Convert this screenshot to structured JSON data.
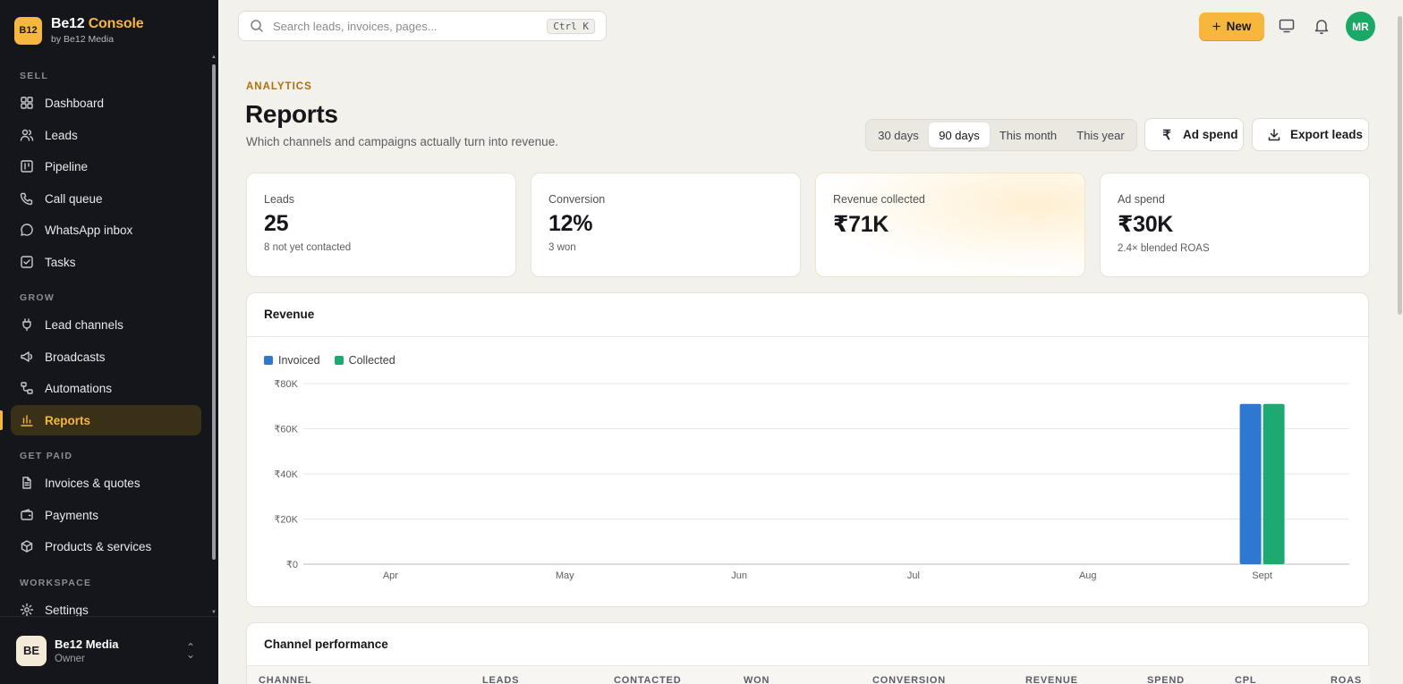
{
  "brand": {
    "logo_text": "B12",
    "name_first": "Be12",
    "name_second": "Console",
    "sub": "by Be12 Media"
  },
  "sidebar": {
    "sections": [
      {
        "label": "SELL",
        "items": [
          {
            "label": "Dashboard",
            "icon": "grid-icon"
          },
          {
            "label": "Leads",
            "icon": "users-icon"
          },
          {
            "label": "Pipeline",
            "icon": "kanban-icon"
          },
          {
            "label": "Call queue",
            "icon": "phone-icon"
          },
          {
            "label": "WhatsApp inbox",
            "icon": "chat-icon"
          },
          {
            "label": "Tasks",
            "icon": "checkbox-icon"
          }
        ]
      },
      {
        "label": "GROW",
        "items": [
          {
            "label": "Lead channels",
            "icon": "plug-icon"
          },
          {
            "label": "Broadcasts",
            "icon": "megaphone-icon"
          },
          {
            "label": "Automations",
            "icon": "workflow-icon"
          },
          {
            "label": "Reports",
            "icon": "bar-chart-icon",
            "active": true
          }
        ]
      },
      {
        "label": "GET PAID",
        "items": [
          {
            "label": "Invoices & quotes",
            "icon": "document-icon"
          },
          {
            "label": "Payments",
            "icon": "wallet-icon"
          },
          {
            "label": "Products & services",
            "icon": "box-icon"
          }
        ]
      },
      {
        "label": "WORKSPACE",
        "items": [
          {
            "label": "Settings",
            "icon": "gear-icon"
          }
        ]
      }
    ],
    "account": {
      "initials": "BE",
      "name": "Be12 Media",
      "role": "Owner"
    }
  },
  "topbar": {
    "search_placeholder": "Search leads, invoices, pages...",
    "shortcut": "Ctrl K",
    "new_label": "New",
    "user_initials": "MR"
  },
  "header": {
    "eyebrow": "ANALYTICS",
    "title": "Reports",
    "subtitle": "Which channels and campaigns actually turn into revenue.",
    "ranges": [
      "30 days",
      "90 days",
      "This month",
      "This year"
    ],
    "active_range": "90 days",
    "ad_spend_label": "Ad spend",
    "export_label": "Export leads"
  },
  "stats": [
    {
      "label": "Leads",
      "value": "25",
      "note": "8 not yet contacted"
    },
    {
      "label": "Conversion",
      "value": "12%",
      "note": "3 won"
    },
    {
      "label": "Revenue collected",
      "value": "₹71K",
      "note": ""
    },
    {
      "label": "Ad spend",
      "value": "₹30K",
      "note": "2.4× blended ROAS"
    }
  ],
  "revenue": {
    "title": "Revenue",
    "colors": {
      "Invoiced": "#2f78d2",
      "Collected": "#1daa72"
    }
  },
  "chart_data": {
    "type": "bar",
    "title": "Revenue",
    "categories": [
      "Apr",
      "May",
      "Jun",
      "Jul",
      "Aug",
      "Sept"
    ],
    "series": [
      {
        "name": "Invoiced",
        "values": [
          0,
          0,
          0,
          0,
          0,
          71000
        ]
      },
      {
        "name": "Collected",
        "values": [
          0,
          0,
          0,
          0,
          0,
          71000
        ]
      }
    ],
    "y_ticks": [
      "₹0",
      "₹20K",
      "₹40K",
      "₹60K",
      "₹80K"
    ],
    "ylim": [
      0,
      80000
    ],
    "grid": true,
    "legend": "top-left"
  },
  "channel_performance": {
    "title": "Channel performance",
    "columns": [
      "CHANNEL",
      "LEADS",
      "CONTACTED",
      "WON",
      "CONVERSION",
      "REVENUE",
      "SPEND",
      "CPL",
      "ROAS"
    ]
  }
}
